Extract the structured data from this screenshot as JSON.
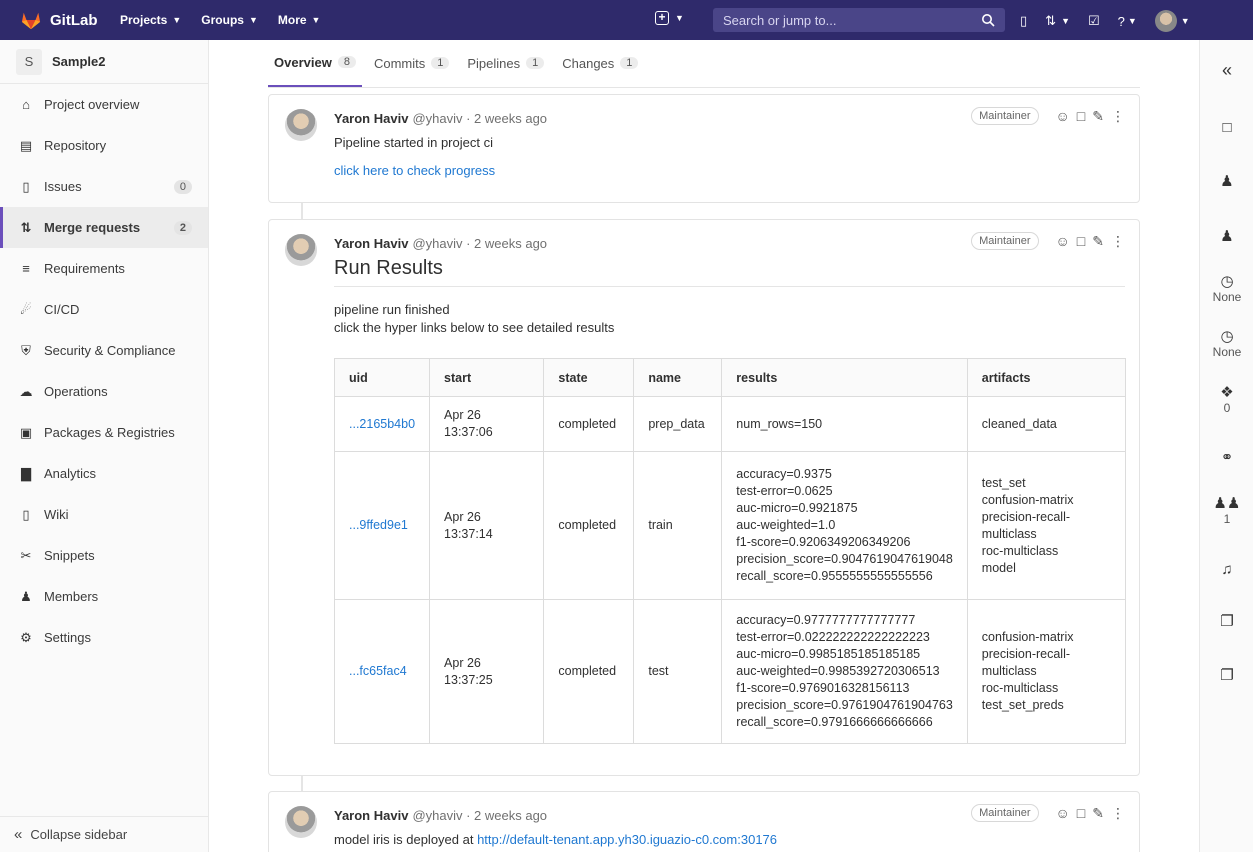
{
  "topbar": {
    "brand": "GitLab",
    "nav": [
      {
        "label": "Projects",
        "chevron": true
      },
      {
        "label": "Groups",
        "chevron": true
      },
      {
        "label": "More",
        "chevron": true
      }
    ],
    "search_placeholder": "Search or jump to...",
    "brand_color": "#2f2a6b"
  },
  "project": {
    "avatar_letter": "S",
    "name": "Sample2"
  },
  "sidebar": {
    "items": [
      {
        "icon": "home-icon",
        "label": "Project overview",
        "count": ""
      },
      {
        "icon": "repository-icon",
        "label": "Repository",
        "count": ""
      },
      {
        "icon": "issues-icon",
        "label": "Issues",
        "count": "0"
      },
      {
        "icon": "merge-request-icon",
        "label": "Merge requests",
        "count": "2"
      },
      {
        "icon": "requirements-icon",
        "label": "Requirements",
        "count": ""
      },
      {
        "icon": "rocket-icon",
        "label": "CI/CD",
        "count": ""
      },
      {
        "icon": "shield-icon",
        "label": "Security & Compliance",
        "count": ""
      },
      {
        "icon": "cloud-icon",
        "label": "Operations",
        "count": ""
      },
      {
        "icon": "package-icon",
        "label": "Packages & Registries",
        "count": ""
      },
      {
        "icon": "chart-icon",
        "label": "Analytics",
        "count": ""
      },
      {
        "icon": "book-icon",
        "label": "Wiki",
        "count": ""
      },
      {
        "icon": "scissors-icon",
        "label": "Snippets",
        "count": ""
      },
      {
        "icon": "users-icon",
        "label": "Members",
        "count": ""
      },
      {
        "icon": "gear-icon",
        "label": "Settings",
        "count": ""
      }
    ],
    "active_index": 3,
    "collapse_label": "Collapse sidebar"
  },
  "tabs": [
    {
      "label": "Overview",
      "count": "8"
    },
    {
      "label": "Commits",
      "count": "1"
    },
    {
      "label": "Pipelines",
      "count": "1"
    },
    {
      "label": "Changes",
      "count": "1"
    }
  ],
  "rightbar": {
    "time_estimate": "None",
    "time_spent": "None",
    "labels": "0",
    "participants": "1"
  },
  "notes": {
    "n1": {
      "author": "Yaron Haviv",
      "meta": "@yhaviv · 2 weeks ago",
      "role": "Maintainer",
      "line1": "Pipeline started in project ci",
      "link": "click here to check progress"
    },
    "n2": {
      "author": "Yaron Haviv",
      "meta": "@yhaviv · 2 weeks ago",
      "role": "Maintainer",
      "title": "Run Results",
      "line1": "pipeline run finished",
      "line2": "click the hyper links below to see detailed results"
    },
    "n3": {
      "author": "Yaron Haviv",
      "meta": "@yhaviv · 2 weeks ago",
      "role": "Maintainer",
      "text_prefix": "model iris is deployed at ",
      "link": "http://default-tenant.app.yh30.iguazio-c0.com:30176"
    }
  },
  "results_table": {
    "headers": [
      "uid",
      "start",
      "state",
      "name",
      "results",
      "artifacts"
    ],
    "rows": [
      {
        "uid": "...2165b4b0",
        "start": [
          "Apr 26",
          "13:37:06"
        ],
        "state": "completed",
        "name": "prep_data",
        "results": [
          "num_rows=150"
        ],
        "artifacts": [
          "cleaned_data"
        ]
      },
      {
        "uid": "...9ffed9e1",
        "start": [
          "Apr 26",
          "13:37:14"
        ],
        "state": "completed",
        "name": "train",
        "results": [
          "accuracy=0.9375",
          "test-error=0.0625",
          "auc-micro=0.9921875",
          "auc-weighted=1.0",
          "f1-score=0.9206349206349206",
          "precision_score=0.9047619047619048",
          "recall_score=0.9555555555555556"
        ],
        "artifacts": [
          "test_set",
          "confusion-matrix",
          "precision-recall-",
          "multiclass",
          "roc-multiclass",
          "model"
        ]
      },
      {
        "uid": "...fc65fac4",
        "start": [
          "Apr 26",
          "13:37:25"
        ],
        "state": "completed",
        "name": "test",
        "results": [
          "accuracy=0.9777777777777777",
          "test-error=0.022222222222222223",
          "auc-micro=0.9985185185185185",
          "auc-weighted=0.9985392720306513",
          "f1-score=0.9769016328156113",
          "precision_score=0.9761904761904763",
          "recall_score=0.9791666666666666"
        ],
        "artifacts": [
          "confusion-matrix",
          "precision-recall-",
          "multiclass",
          "roc-multiclass",
          "test_set_preds"
        ]
      }
    ]
  }
}
